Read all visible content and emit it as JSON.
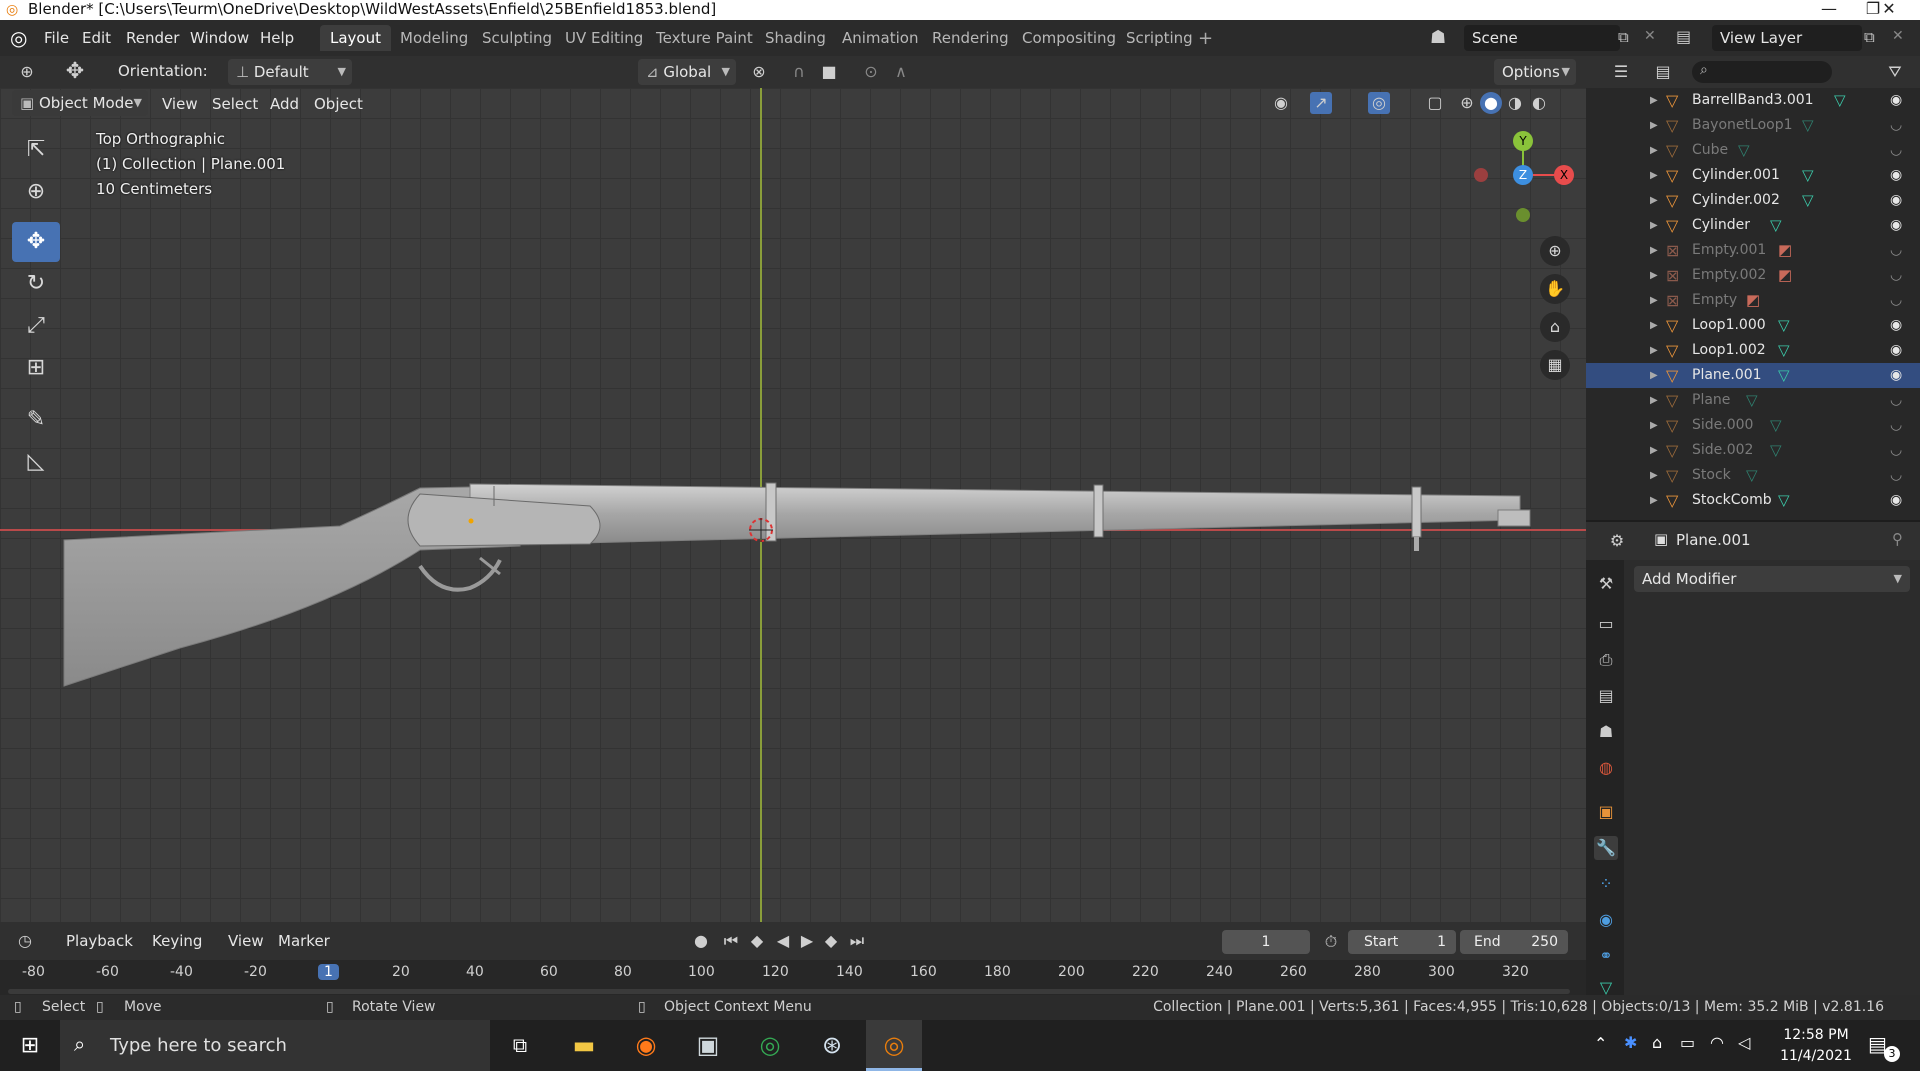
{
  "window": {
    "title": "Blender* [C:\\Users\\Teurm\\OneDrive\\Desktop\\WildWestAssets\\Enfield\\25BEnfield1853.blend]",
    "controls": [
      "—",
      "❐",
      "✕"
    ]
  },
  "menu": [
    "File",
    "Edit",
    "Render",
    "Window",
    "Help"
  ],
  "workspaces": [
    {
      "label": "Layout",
      "active": true
    },
    {
      "label": "Modeling"
    },
    {
      "label": "Sculpting"
    },
    {
      "label": "UV Editing"
    },
    {
      "label": "Texture Paint"
    },
    {
      "label": "Shading"
    },
    {
      "label": "Animation"
    },
    {
      "label": "Rendering"
    },
    {
      "label": "Compositing"
    },
    {
      "label": "Scripting"
    }
  ],
  "scene": {
    "label": "Scene"
  },
  "view_layer": {
    "label": "View Layer"
  },
  "viewport_header": {
    "orientation_label": "Orientation:",
    "orientation_value": "Default",
    "transform_space": "Global",
    "options": "Options",
    "mode": "Object Mode",
    "menus": [
      "View",
      "Select",
      "Add",
      "Object"
    ]
  },
  "viewport_overlay": {
    "view_name": "Top Orthographic",
    "collection": "(1) Collection | Plane.001",
    "scale": "10 Centimeters"
  },
  "gizmo": {
    "y": "Y",
    "z": "Z",
    "x": "X"
  },
  "outliner": {
    "items": [
      {
        "name": "BarrellBand3.001",
        "type": "mesh",
        "visible": true
      },
      {
        "name": "BayonetLoop1",
        "type": "mesh",
        "visible": false
      },
      {
        "name": "Cube",
        "type": "mesh",
        "visible": false
      },
      {
        "name": "Cylinder.001",
        "type": "mesh",
        "visible": true
      },
      {
        "name": "Cylinder.002",
        "type": "mesh",
        "visible": true
      },
      {
        "name": "Cylinder",
        "type": "mesh",
        "visible": true
      },
      {
        "name": "Empty.001",
        "type": "empty",
        "visible": false
      },
      {
        "name": "Empty.002",
        "type": "empty",
        "visible": false
      },
      {
        "name": "Empty",
        "type": "empty",
        "visible": false
      },
      {
        "name": "Loop1.000",
        "type": "mesh",
        "visible": true
      },
      {
        "name": "Loop1.002",
        "type": "mesh",
        "visible": true
      },
      {
        "name": "Plane.001",
        "type": "mesh",
        "visible": true,
        "selected": true
      },
      {
        "name": "Plane",
        "type": "mesh",
        "visible": false
      },
      {
        "name": "Side.000",
        "type": "mesh",
        "visible": false
      },
      {
        "name": "Side.002",
        "type": "mesh",
        "visible": false
      },
      {
        "name": "Stock",
        "type": "mesh",
        "visible": false
      },
      {
        "name": "StockComb",
        "type": "mesh",
        "visible": true
      }
    ]
  },
  "properties": {
    "object_name": "Plane.001",
    "add_modifier": "Add Modifier"
  },
  "timeline": {
    "menus": [
      "Playback",
      "Keying",
      "View",
      "Marker"
    ],
    "current_frame": "1",
    "start_label": "Start",
    "start_value": "1",
    "end_label": "End",
    "end_value": "250",
    "ticks": [
      "-80",
      "-60",
      "-40",
      "-20",
      "1",
      "20",
      "40",
      "60",
      "80",
      "100",
      "120",
      "140",
      "160",
      "180",
      "200",
      "220",
      "240",
      "260",
      "280",
      "300",
      "320"
    ]
  },
  "statusbar": {
    "select": "Select",
    "move": "Move",
    "rotate": "Rotate View",
    "context": "Object Context Menu",
    "stats": "Collection | Plane.001 | Verts:5,361 | Faces:4,955 | Tris:10,628 | Objects:0/13 | Mem: 35.2 MiB | v2.81.16"
  },
  "taskbar": {
    "search_placeholder": "Type here to search",
    "time": "12:58 PM",
    "date": "11/4/2021",
    "notifications": "3"
  },
  "colors": {
    "accent": "#4772b3",
    "x_axis": "#e74c4c",
    "y_axis": "#8ac33a",
    "z_axis": "#3d8fe0",
    "mesh_icon": "#e8933a",
    "mesh_data_icon": "#3bc8a8"
  }
}
